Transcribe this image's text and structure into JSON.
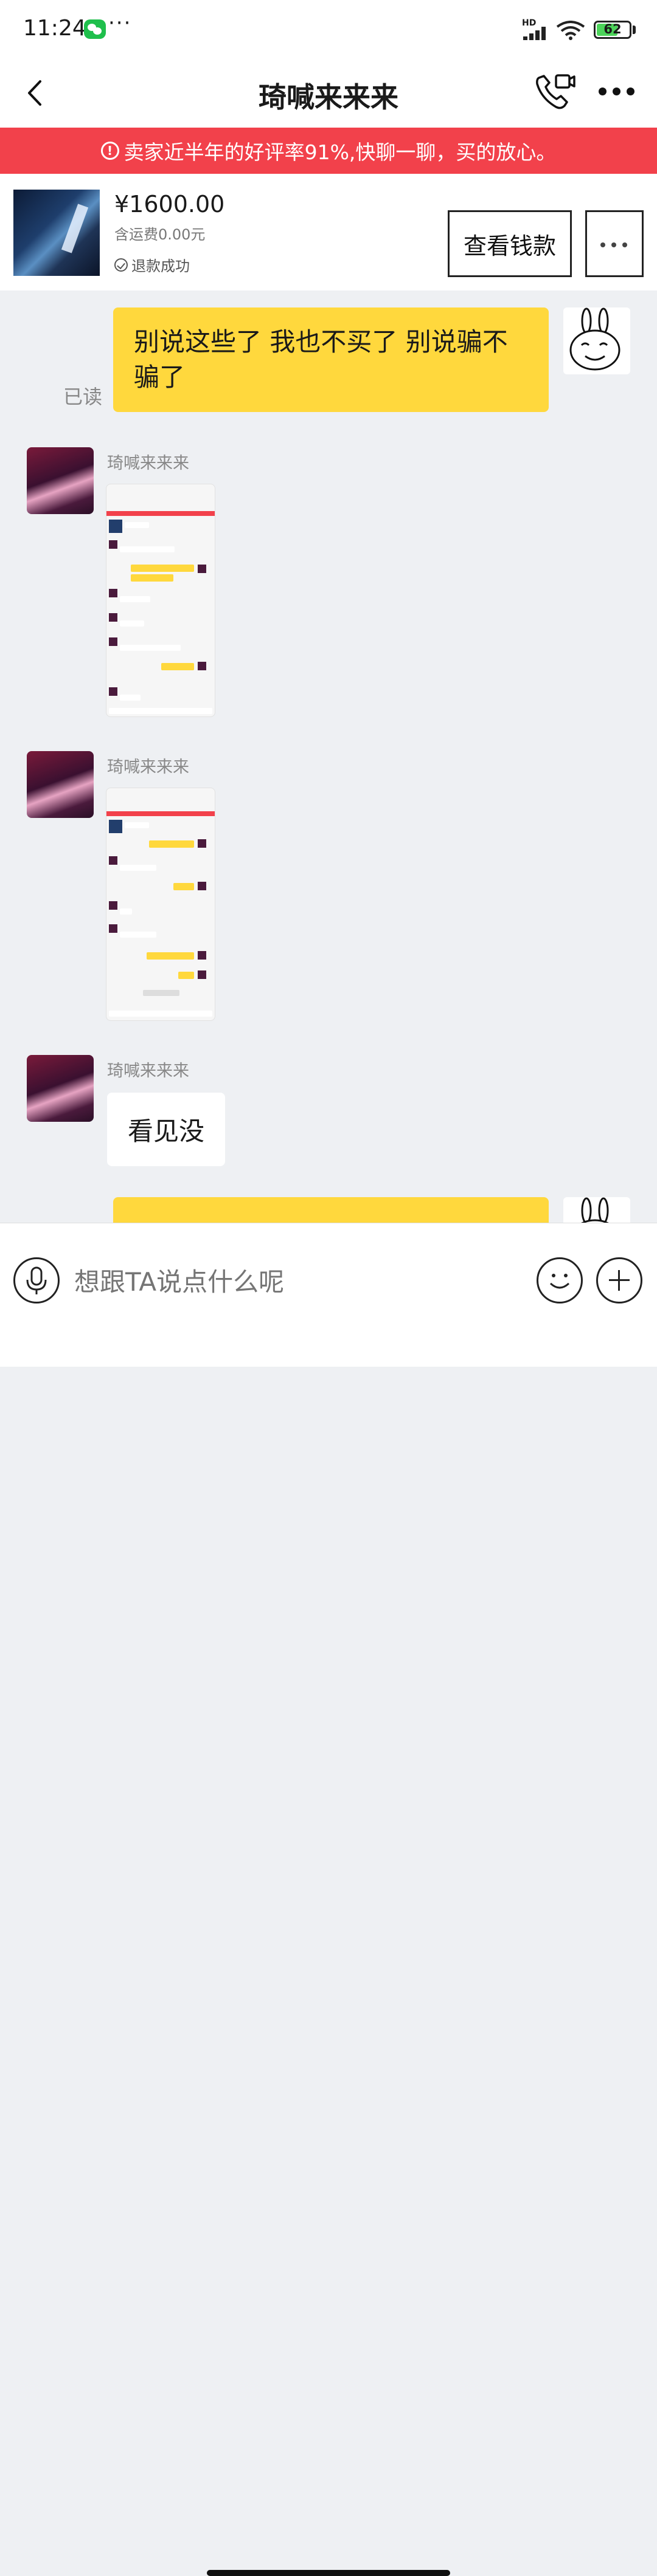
{
  "status_bar": {
    "time": "11:24",
    "more": "···",
    "hd": "HD",
    "battery": "62"
  },
  "header": {
    "title": "琦喊来来来"
  },
  "banner": {
    "icon": "!",
    "text": "卖家近半年的好评率91%,快聊一聊，买的放心。"
  },
  "product": {
    "price": "¥1600.00",
    "shipping": "含运费0.00元",
    "status": "退款成功",
    "view_button": "查看钱款"
  },
  "messages": [
    {
      "type": "text",
      "direction": "out",
      "text": "别说这些了 我也不买了 别说骗不骗了",
      "read_status": "已读"
    },
    {
      "type": "image",
      "direction": "in",
      "sender": "琦喊来来来"
    },
    {
      "type": "image",
      "direction": "in",
      "sender": "琦喊来来来"
    },
    {
      "type": "text",
      "direction": "in",
      "sender": "琦喊来来来",
      "text": "看见没"
    },
    {
      "type": "text",
      "direction": "out",
      "text": ""
    }
  ],
  "input": {
    "placeholder": "想跟TA说点什么呢"
  },
  "colors": {
    "banner": "#f2414b",
    "outgoing_bubble": "#ffd83d",
    "background": "#eef0f3"
  }
}
